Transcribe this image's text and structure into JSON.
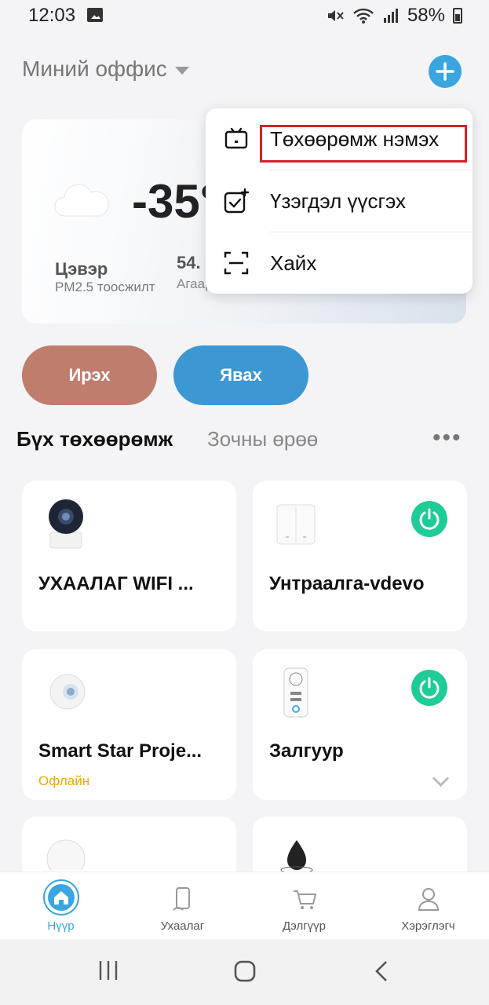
{
  "status_bar": {
    "time": "12:03",
    "battery": "58%"
  },
  "header": {
    "home_name": "Миний оффис"
  },
  "weather": {
    "temperature": "-35°",
    "air_quality": "Цэвэр",
    "air_quality_label": "PM2.5 тоосжилт",
    "humidity_value": "54.",
    "humidity_label": "Агаар"
  },
  "scenes": [
    {
      "label": "Ирэх",
      "color": "#bf7d6d"
    },
    {
      "label": "Явах",
      "color": "#3c97d2"
    }
  ],
  "tabs": {
    "all": "Бүх төхөөрөмж",
    "guest": "Зочны өрөө"
  },
  "devices": [
    {
      "name": "УХААЛАГ WIFI ...",
      "status": ""
    },
    {
      "name": "Унтраалга-vdevo",
      "status": ""
    },
    {
      "name": "Smart Star Proje...",
      "status": "Офлайн"
    },
    {
      "name": "Залгуур",
      "status": ""
    }
  ],
  "menu": {
    "items": [
      {
        "label": "Төхөөрөмж нэмэх",
        "icon": "add-device-icon"
      },
      {
        "label": "Үзэгдэл үүсгэх",
        "icon": "create-scene-icon"
      },
      {
        "label": "Хайх",
        "icon": "scan-icon"
      }
    ]
  },
  "bottom_nav": [
    {
      "label": "Нүүр",
      "icon": "home-icon",
      "active": true
    },
    {
      "label": "Ухаалаг",
      "icon": "smart-icon",
      "active": false
    },
    {
      "label": "Дэлгүүр",
      "icon": "cart-icon",
      "active": false
    },
    {
      "label": "Хэрэглэгч",
      "icon": "user-icon",
      "active": false
    }
  ],
  "colors": {
    "accent": "#3aa5de",
    "power_on": "#1fcc97",
    "offline": "#f0a800",
    "highlight_box": "#d8202c"
  }
}
